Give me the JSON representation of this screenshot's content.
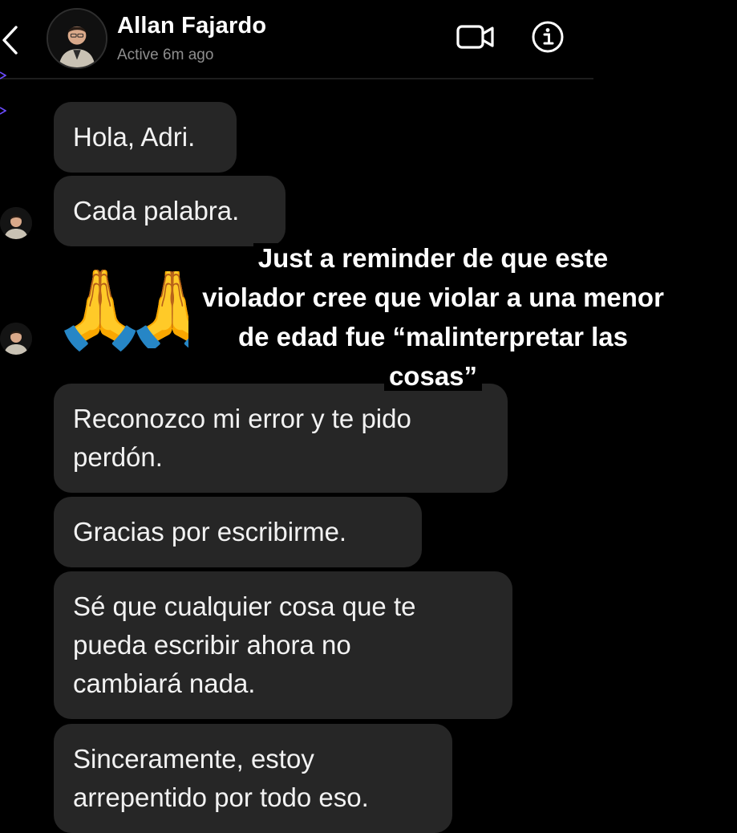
{
  "header": {
    "contact_name": "Allan Fajardo",
    "status": "Active 6m ago",
    "back_icon": "chevron-left-icon",
    "video_icon": "video-camera-icon",
    "info_icon": "info-icon"
  },
  "messages": [
    {
      "text": "Hola, Adri."
    },
    {
      "text": "Cada palabra."
    },
    {
      "emoji": "🙏"
    },
    {
      "text": "Reconozco mi error y te pido perdón.",
      "lines": [
        "Reconozco mi error y te pido",
        "perdón."
      ]
    },
    {
      "text": "Gracias por escribirme."
    },
    {
      "text": "Sé que cualquier cosa que te pueda escribir ahora no cambiará nada.",
      "lines": [
        "Sé que cualquier cosa que te",
        "pueda escribir ahora no",
        "cambiará nada."
      ]
    },
    {
      "text": "Sinceramente, estoy arrepentido por todo eso.",
      "lines": [
        "Sinceramente, estoy",
        "arrepentido por todo eso."
      ]
    }
  ],
  "overlay_caption": {
    "lines": [
      "Just a reminder de que este",
      "violador cree que violar a una menor",
      "de edad fue “malinterpretar las",
      "cosas”"
    ]
  },
  "colors": {
    "background": "#000000",
    "bubble": "#262626",
    "text": "#ffffff",
    "muted": "#8e8e8e"
  }
}
